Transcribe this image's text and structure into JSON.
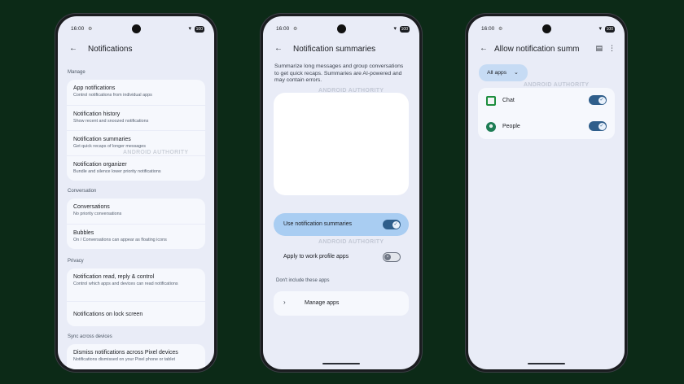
{
  "status": {
    "time": "16:00",
    "battery": "100"
  },
  "icons": {
    "back": "arrow-left-icon",
    "gear": "gear-icon",
    "wifi": "wifi-icon",
    "check": "check-icon",
    "close": "x-icon",
    "chevron_right": "chevron-right-icon",
    "chevron_down": "chevron-down-icon",
    "more": "more-vert-icon",
    "doc": "document-icon"
  },
  "watermark": "ANDROID AUTHORITY",
  "screen1": {
    "title": "Notifications",
    "sections": {
      "manage": "Manage",
      "conversation": "Conversation",
      "privacy": "Privacy",
      "sync": "Sync across devices"
    },
    "manage_items": [
      {
        "title": "App notifications",
        "subtitle": "Control notifications from individual apps"
      },
      {
        "title": "Notification history",
        "subtitle": "Show recent and snoozed notifications"
      },
      {
        "title": "Notification summaries",
        "subtitle": "Get quick recaps of longer messages"
      },
      {
        "title": "Notification organizer",
        "subtitle": "Bundle and silence lower priority notifications"
      }
    ],
    "conversation_items": [
      {
        "title": "Conversations",
        "subtitle": "No priority conversations"
      },
      {
        "title": "Bubbles",
        "subtitle": "On / Conversations can appear as floating icons"
      }
    ],
    "privacy_items": [
      {
        "title": "Notification read, reply & control",
        "subtitle": "Control which apps and devices can read notifications"
      },
      {
        "title": "Notifications on lock screen",
        "subtitle": ""
      }
    ],
    "sync_items": [
      {
        "title": "Dismiss notifications across Pixel devices",
        "subtitle": "Notifications dismissed on your Pixel phone or tablet"
      }
    ]
  },
  "screen2": {
    "title": "Notification summaries",
    "description": "Summarize long messages and group conversations to get quick recaps. Summaries are AI-powered and may contain errors.",
    "use_label": "Use notification summaries",
    "use_on": true,
    "work_label": "Apply to work profile apps",
    "work_on": false,
    "exclude_label": "Don't include these apps",
    "manage_label": "Manage apps"
  },
  "screen3": {
    "title": "Allow notification summ",
    "filter_label": "All apps",
    "apps": [
      {
        "name": "Chat",
        "enabled": true
      },
      {
        "name": "People",
        "enabled": true
      }
    ]
  }
}
